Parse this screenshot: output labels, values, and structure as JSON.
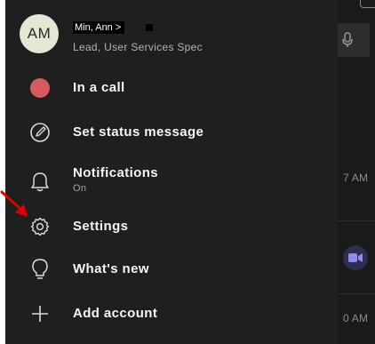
{
  "profile": {
    "initials": "AM",
    "name": "Min, Ann >",
    "title": "Lead, User Services Spec"
  },
  "menu": {
    "items": [
      {
        "label": "In a call",
        "icon": "status-dot-icon",
        "status_color": "#d85a5e"
      },
      {
        "label": "Set status message",
        "icon": "pencil-icon"
      },
      {
        "label": "Notifications",
        "sublabel": "On",
        "icon": "bell-icon"
      },
      {
        "label": "Settings",
        "icon": "gear-icon"
      },
      {
        "label": "What's new",
        "icon": "lightbulb-icon"
      },
      {
        "label": "Add account",
        "icon": "plus-icon"
      }
    ]
  },
  "background": {
    "times": [
      "7 AM",
      "0 AM"
    ]
  },
  "annotation": {
    "arrow_color": "#e00000",
    "points_to": "Settings"
  }
}
